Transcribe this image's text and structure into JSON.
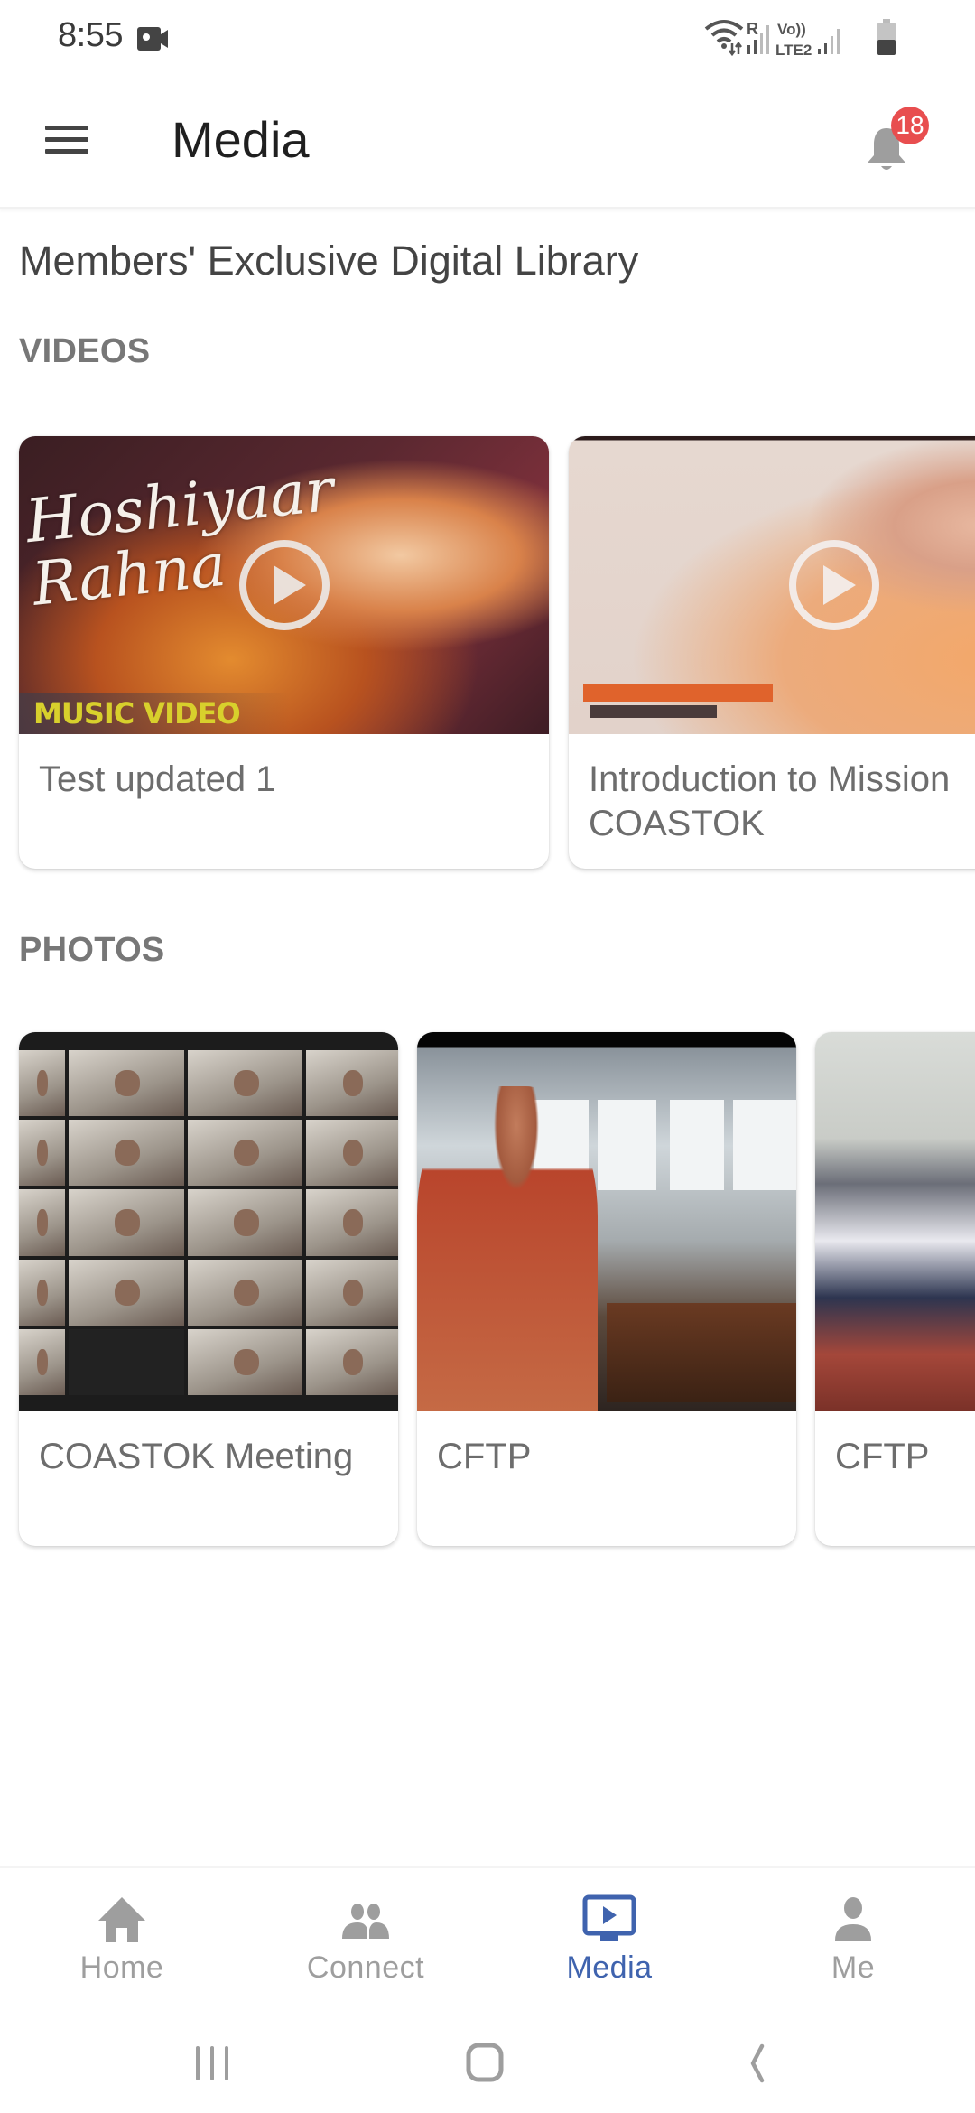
{
  "status_bar": {
    "time": "8:55",
    "icons": [
      "video-record-icon",
      "wifi-data-icon",
      "roaming-signal-icon",
      "volte-lte2-signal-icon",
      "battery-icon"
    ],
    "roaming_label": "R",
    "volte_label": "Vo))",
    "network_label": "LTE2"
  },
  "app_bar": {
    "title": "Media",
    "menu_icon": "hamburger-menu-icon",
    "notification_icon": "bell-icon",
    "notification_count": "18",
    "badge_color": "#e84e4f"
  },
  "main": {
    "library_title": "Members' Exclusive Digital Library",
    "videos": {
      "heading": "VIDEOS",
      "items": [
        {
          "title": "Test updated 1",
          "thumbnail_overlay_text": "Hoshiyaar Rahna",
          "thumbnail_badge_text": "MUSIC VIDEO",
          "icon": "play-circle-icon"
        },
        {
          "title": "Introduction to Mission COASTOK",
          "icon": "play-circle-icon"
        }
      ]
    },
    "photos": {
      "heading": "PHOTOS",
      "items": [
        {
          "title": "COASTOK Meeting"
        },
        {
          "title": "CFTP"
        },
        {
          "title": "CFTP"
        }
      ]
    }
  },
  "bottom_nav": {
    "active_color": "#3f63ae",
    "inactive_color": "#9e9e9e",
    "items": [
      {
        "label": "Home",
        "icon": "home-icon",
        "active": false
      },
      {
        "label": "Connect",
        "icon": "people-icon",
        "active": false
      },
      {
        "label": "Media",
        "icon": "media-play-screen-icon",
        "active": true
      },
      {
        "label": "Me",
        "icon": "person-icon",
        "active": false
      }
    ]
  },
  "system_nav": {
    "items": [
      "recent-apps-icon",
      "home-button-icon",
      "back-icon"
    ]
  }
}
